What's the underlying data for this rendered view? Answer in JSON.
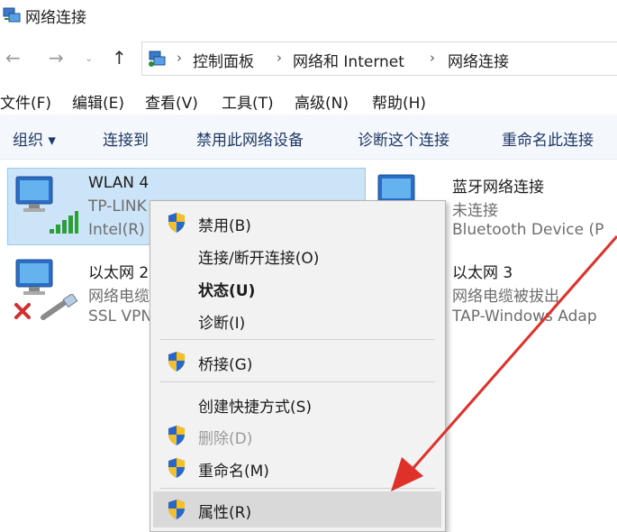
{
  "window": {
    "title": "网络连接"
  },
  "address": {
    "crumbs": [
      "控制面板",
      "网络和 Internet",
      "网络连接"
    ],
    "separator": "›",
    "nav": {
      "back": "←",
      "forward": "→",
      "recent": "⌄",
      "up": "↑"
    }
  },
  "menubar": [
    "文件(F)",
    "编辑(E)",
    "查看(V)",
    "工具(T)",
    "高级(N)",
    "帮助(H)"
  ],
  "commands": [
    "组织 ▾",
    "连接到",
    "禁用此网络设备",
    "诊断这个连接",
    "重命名此连接"
  ],
  "connections": [
    {
      "name": "WLAN 4",
      "status": "TP-LINK",
      "device": "Intel(R)"
    },
    {
      "name": "以太网 2",
      "status": "网络电缆",
      "device": "SSL VPN"
    },
    {
      "name": "蓝牙网络连接",
      "status": "未连接",
      "device": "Bluetooth Device (P"
    },
    {
      "name": "以太网 3",
      "status": "网络电缆被拔出",
      "device": "TAP-Windows Adap"
    }
  ],
  "context_menu": {
    "items": [
      {
        "label": "禁用(B)",
        "shield": true
      },
      {
        "label": "连接/断开连接(O)",
        "shield": false
      },
      {
        "label": "状态(U)",
        "shield": false,
        "bold": true
      },
      {
        "label": "诊断(I)",
        "shield": false
      },
      {
        "label": "桥接(G)",
        "shield": true
      },
      {
        "label": "创建快捷方式(S)",
        "shield": false
      },
      {
        "label": "删除(D)",
        "shield": true,
        "disabled": true
      },
      {
        "label": "重命名(M)",
        "shield": true
      },
      {
        "label": "属性(R)",
        "shield": true,
        "highlighted": true
      }
    ]
  },
  "colors": {
    "selection": "#cce4f7",
    "command_text": "#1e3966",
    "arrow": "#e0302a",
    "error_x": "#d32f2f"
  }
}
